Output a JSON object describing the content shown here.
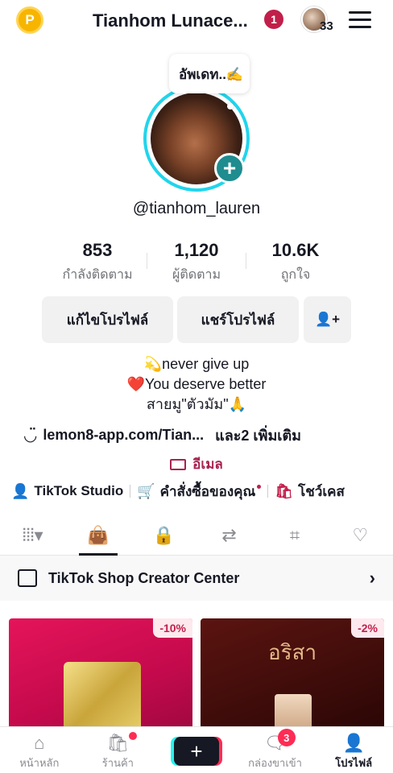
{
  "header": {
    "coin_label": "P",
    "title": "Tianhom Lunace...",
    "notification_count": "1",
    "account_count": "33"
  },
  "profile": {
    "update_bubble": "อัพเดท..✍️",
    "plus": "+",
    "handle": "@tianhom_lauren"
  },
  "stats": [
    {
      "value": "853",
      "label": "กำลังติดตาม"
    },
    {
      "value": "1,120",
      "label": "ผู้ติดตาม"
    },
    {
      "value": "10.6K",
      "label": "ถูกใจ"
    }
  ],
  "buttons": {
    "edit": "แก้ไขโปรไฟล์",
    "share": "แชร์โปรไฟล์",
    "add_friend_icon": "👤+"
  },
  "bio": {
    "line1": "💫never give up",
    "line2": "❤️You deserve better",
    "line3": "สายมู\"ตัวมัม\"🙏"
  },
  "link": {
    "url": "lemon8-app.com/Tian...",
    "more": "และ2 เพิ่มเติม"
  },
  "email_label": "อีเมล",
  "shortcuts": {
    "studio": "TikTok Studio",
    "orders": "คำสั่งซื้อของคุณ",
    "showcase": "โชว์เคส"
  },
  "shop_banner": {
    "label": "TikTok Shop Creator Center",
    "chevron": "›"
  },
  "products": [
    {
      "discount": "-10%"
    },
    {
      "discount": "-2%",
      "brand": "อริสา"
    }
  ],
  "bottom_nav": {
    "home": "หน้าหลัก",
    "shop": "ร้านค้า",
    "create": "+",
    "inbox": "กล่องขาเข้า",
    "inbox_count": "3",
    "profile": "โปรไฟล์"
  },
  "colors": {
    "accent_red": "#c11f4a",
    "ring": "#20d5ec",
    "plus_bg": "#1f8c8f"
  }
}
